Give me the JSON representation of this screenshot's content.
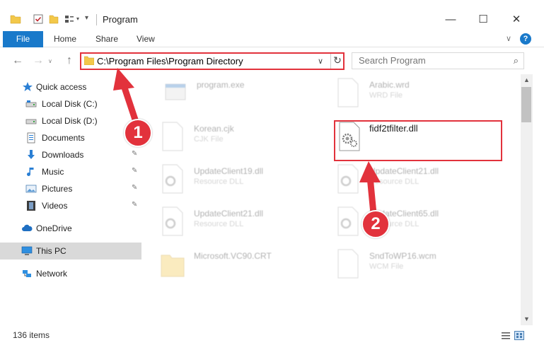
{
  "window": {
    "title": "Program",
    "minimize_glyph": "—",
    "maximize_glyph": "☐",
    "close_glyph": "✕"
  },
  "ribbon": {
    "tabs": [
      "File",
      "Home",
      "Share",
      "View"
    ],
    "help_glyph": "?"
  },
  "address": {
    "path": "C:\\Program Files\\Program Directory",
    "back_glyph": "←",
    "forward_glyph": "→",
    "up_glyph": "↑",
    "dropdown_glyph": "∨",
    "refresh_glyph": "↻"
  },
  "search": {
    "placeholder": "Search Program"
  },
  "sidebar": {
    "items": [
      {
        "label": "Quick access",
        "icon": "star-icon",
        "pinned": false
      },
      {
        "label": "Local Disk (C:)",
        "icon": "drive-icon",
        "pinned": false
      },
      {
        "label": "Local Disk (D:)",
        "icon": "drive-icon",
        "pinned": false
      },
      {
        "label": "Documents",
        "icon": "documents-icon",
        "pinned": true
      },
      {
        "label": "Downloads",
        "icon": "download-icon",
        "pinned": true
      },
      {
        "label": "Music",
        "icon": "music-icon",
        "pinned": true
      },
      {
        "label": "Pictures",
        "icon": "pictures-icon",
        "pinned": true
      },
      {
        "label": "Videos",
        "icon": "videos-icon",
        "pinned": true
      },
      {
        "label": "OneDrive",
        "icon": "cloud-icon",
        "pinned": false
      },
      {
        "label": "This PC",
        "icon": "computer-icon",
        "pinned": false,
        "selected": true
      },
      {
        "label": "Network",
        "icon": "network-icon",
        "pinned": false
      }
    ],
    "pin_glyph": "📌"
  },
  "files": [
    {
      "name": "program.exe",
      "type": "",
      "icon": "exe-icon"
    },
    {
      "name": "Arabic.wrd",
      "type": "WRD File",
      "icon": "blank-file-icon"
    },
    {
      "name": "Korean.cjk",
      "type": "CJK File",
      "icon": "blank-file-icon"
    },
    {
      "name": "fidf2tfilter.dll",
      "type": "",
      "icon": "dll-gear-icon",
      "highlighted": true
    },
    {
      "name": "UpdateClient19.dll",
      "type": "Resource DLL",
      "icon": "dll-gear-icon"
    },
    {
      "name": "UpdateClient21.dll",
      "type": "Resource DLL",
      "icon": "dll-gear-icon"
    },
    {
      "name": "UpdateClient21.dll",
      "type": "Resource DLL",
      "icon": "dll-gear-icon"
    },
    {
      "name": "UpdateClient65.dll",
      "type": "Resource DLL",
      "icon": "dll-gear-icon"
    },
    {
      "name": "Microsoft.VC90.CRT",
      "type": "",
      "icon": "folder-icon"
    },
    {
      "name": "SndToWP16.wcm",
      "type": "WCM File",
      "icon": "blank-file-icon"
    }
  ],
  "status": {
    "item_count": "136 items"
  },
  "callouts": {
    "step1": "1",
    "step2": "2"
  },
  "colors": {
    "accent": "#1979ca",
    "highlight": "#e2323c",
    "folder": "#f3c84a"
  }
}
